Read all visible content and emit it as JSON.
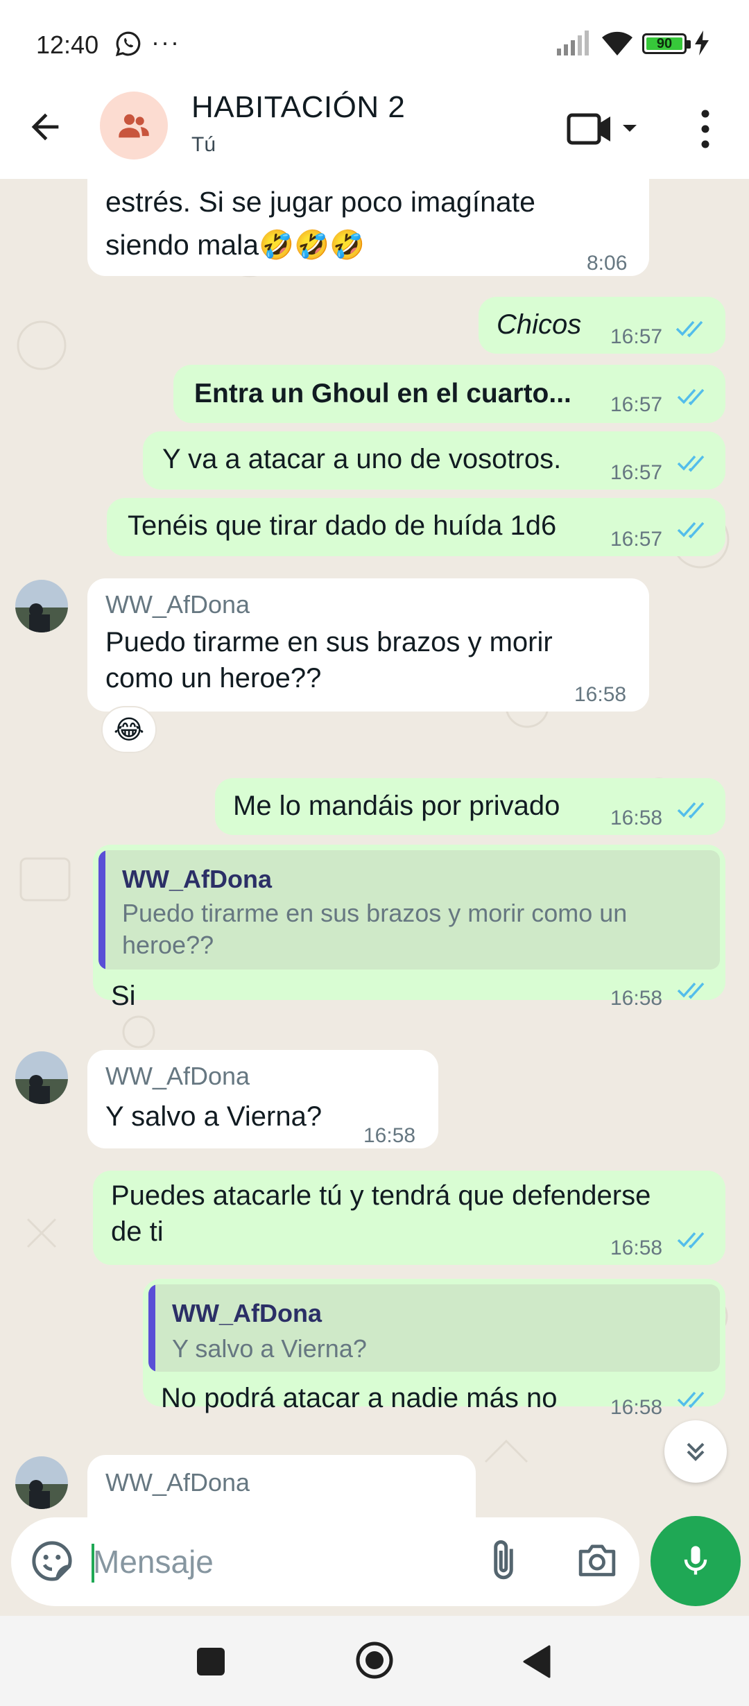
{
  "status_bar": {
    "time": "12:40",
    "notification_icons": [
      "whatsapp-icon",
      "more-dots"
    ],
    "dots": "···",
    "battery": "90",
    "icons": [
      "signal-icon",
      "wifi-icon",
      "battery-icon",
      "charging-icon"
    ]
  },
  "header": {
    "title": "HABITACIÓN 2",
    "subtitle": "Tú",
    "icons": [
      "back-arrow-icon",
      "group-icon",
      "video-call-icon",
      "chevron-down-icon",
      "more-vertical-icon"
    ]
  },
  "messages": [
    {
      "dir": "in",
      "text_line1": "estrés. Si se jugar poco imagínate",
      "text_line2": "siendo mala",
      "emoji": "🤣🤣🤣",
      "time": "8:06"
    },
    {
      "dir": "out",
      "text": "Chicos",
      "style": "italic",
      "time": "16:57"
    },
    {
      "dir": "out",
      "text": "Entra un Ghoul en el cuarto...",
      "style": "bold",
      "time": "16:57"
    },
    {
      "dir": "out",
      "text": "Y va a atacar a uno de vosotros.",
      "time": "16:57"
    },
    {
      "dir": "out",
      "text": "Tenéis que tirar dado de huída 1d6",
      "time": "16:57"
    },
    {
      "dir": "in",
      "sender": "WW_AfDona",
      "text_line1": "Puedo tirarme en sus brazos y morir",
      "text_line2": "como un heroe??",
      "time": "16:58",
      "reaction": "😂"
    },
    {
      "dir": "out",
      "text": "Me lo mandáis por privado",
      "time": "16:58"
    },
    {
      "dir": "out",
      "quote_sender": "WW_AfDona",
      "quote_line1": "Puedo tirarme en sus brazos y morir como un",
      "quote_line2": "heroe??",
      "text": "Si",
      "time": "16:58"
    },
    {
      "dir": "in",
      "sender": "WW_AfDona",
      "text": "Y salvo a Vierna?",
      "time": "16:58"
    },
    {
      "dir": "out",
      "text_line1": "Puedes atacarle tú y tendrá que defenderse",
      "text_line2": "de ti",
      "time": "16:58"
    },
    {
      "dir": "out",
      "quote_sender": "WW_AfDona",
      "quote_text": "Y salvo a Vierna?",
      "text": "No podrá atacar a nadie más no",
      "time": "16:58"
    },
    {
      "dir": "in",
      "sender": "WW_AfDona"
    }
  ],
  "input": {
    "placeholder": "Mensaje",
    "icons": [
      "emoji-sticker-icon",
      "attach-icon",
      "camera-icon",
      "mic-icon"
    ]
  },
  "colors": {
    "outgoing_bubble": "#d9fdd3",
    "incoming_bubble": "#ffffff",
    "accent_green": "#1fa855",
    "read_ticks": "#53bdeb",
    "quote_bar": "#5a4ed6",
    "chat_background": "#efeae2"
  },
  "navigation_bar": {
    "icons": [
      "recents-icon",
      "home-icon",
      "back-icon"
    ]
  }
}
